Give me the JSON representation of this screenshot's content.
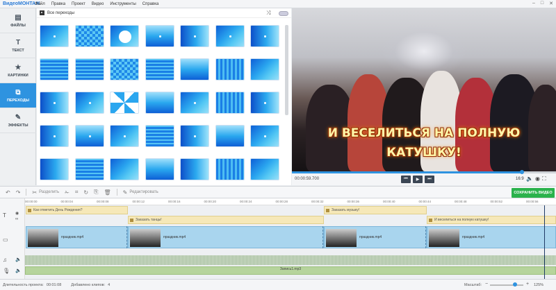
{
  "app": {
    "logo_a": "Видео",
    "logo_b": "МОНТАЖ"
  },
  "menu": [
    "Файл",
    "Правка",
    "Проект",
    "Видео",
    "Инструменты",
    "Справка"
  ],
  "sidebar": {
    "items": [
      {
        "label": "ФАЙЛЫ",
        "icon": "folder-icon"
      },
      {
        "label": "ТЕКСТ",
        "icon": "text-icon"
      },
      {
        "label": "КАРТИНКИ",
        "icon": "star-icon"
      },
      {
        "label": "ПЕРЕХОДЫ",
        "icon": "transitions-icon",
        "active": true
      },
      {
        "label": "ЭФФЕКТЫ",
        "icon": "magic-wand-icon"
      }
    ]
  },
  "panel": {
    "title": "Все переходы"
  },
  "preview": {
    "caption_line1": "И ВЕСЕЛИТЬСЯ НА ПОЛНУЮ",
    "caption_line2": "КАТУШКУ!"
  },
  "player": {
    "timecode": "00:00:59.700",
    "aspect_ratio": "16:9",
    "progress_fraction": 0.87
  },
  "toolbar": {
    "split_label": "Разделить",
    "edit_label": "Редактировать",
    "save_label": "СОХРАНИТЬ ВИДЕО"
  },
  "timeline": {
    "ruler": [
      "00:00:00",
      "00:00:04",
      "00:00:08",
      "00:00:12",
      "00:00:16",
      "00:00:20",
      "00:00:24",
      "00:00:28",
      "00:00:32",
      "00:00:36",
      "00:00:40",
      "00:00:44",
      "00:00:48",
      "00:00:52",
      "00:00:56"
    ],
    "titles": [
      "Как отметить День Рождения?",
      "Заказать танцы!",
      "Заказать музыку!",
      "И веселиться на полную катушку!"
    ],
    "video_clips": [
      "праздник.mp4",
      "праздник.mp4",
      "праздник.mp4",
      "праздник.mp4"
    ],
    "music": "Запись1.mp3"
  },
  "status": {
    "duration_label": "Длительность проекта:",
    "duration_value": "00:01:08",
    "clips_label": "Добавлено клипов:",
    "clips_value": "4",
    "zoom_label": "Масштаб:",
    "zoom_value": "125%"
  }
}
